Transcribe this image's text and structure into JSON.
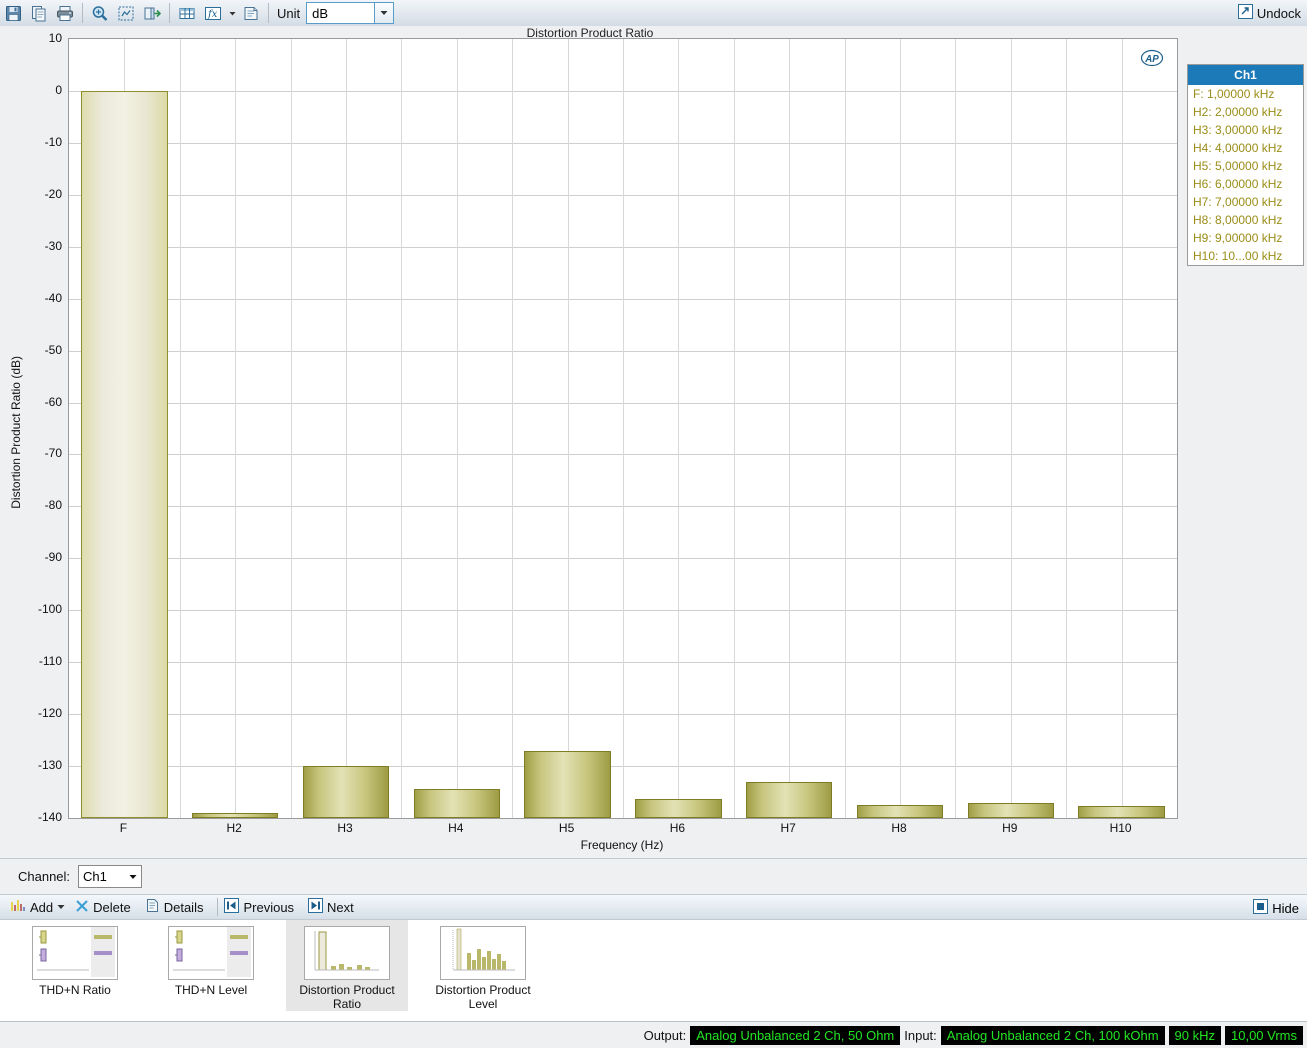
{
  "toolbar": {
    "icons": [
      {
        "name": "save-icon",
        "glyph": "save"
      },
      {
        "name": "copy-icon",
        "glyph": "copy"
      },
      {
        "name": "print-icon",
        "glyph": "print"
      },
      {
        "name": "zoom-icon",
        "glyph": "zoom"
      },
      {
        "name": "fit-icon",
        "glyph": "fit"
      },
      {
        "name": "export-icon",
        "glyph": "export"
      },
      {
        "name": "table-icon",
        "glyph": "table"
      },
      {
        "name": "formula-icon",
        "glyph": "fx"
      },
      {
        "name": "properties-icon",
        "glyph": "props"
      }
    ],
    "unit_label": "Unit",
    "unit_value": "dB",
    "undock_label": "Undock"
  },
  "chart_data": {
    "type": "bar",
    "title": "Distortion Product Ratio",
    "xlabel": "Frequency (Hz)",
    "ylabel": "Distortion Product Ratio (dB)",
    "categories": [
      "F",
      "H2",
      "H3",
      "H4",
      "H5",
      "H6",
      "H7",
      "H8",
      "H9",
      "H10"
    ],
    "values": [
      0,
      -139.0,
      -130.0,
      -134.5,
      -127.0,
      -136.3,
      -133.0,
      -137.5,
      -137.2,
      -137.7
    ],
    "ylim": [
      -140,
      10
    ],
    "yticks": [
      10,
      0,
      -10,
      -20,
      -30,
      -40,
      -50,
      -60,
      -70,
      -80,
      -90,
      -100,
      -110,
      -120,
      -130,
      -140
    ],
    "grid": true,
    "legend_position": "right",
    "series": [
      {
        "name": "Ch1",
        "values": [
          0,
          -139.0,
          -130.0,
          -134.5,
          -127.0,
          -136.3,
          -133.0,
          -137.5,
          -137.2,
          -137.7
        ]
      }
    ],
    "watermark": "AP"
  },
  "legend": {
    "header": "Ch1",
    "items": [
      "F: 1,00000 kHz",
      "H2: 2,00000 kHz",
      "H3: 3,00000 kHz",
      "H4: 4,00000 kHz",
      "H5: 5,00000 kHz",
      "H6: 6,00000 kHz",
      "H7: 7,00000 kHz",
      "H8: 8,00000 kHz",
      "H9: 9,00000 kHz",
      "H10: 10...00 kHz"
    ],
    "header_color": "#1d7ab8",
    "text_color": "#9a8d18"
  },
  "channel_bar": {
    "label": "Channel:",
    "value": "Ch1"
  },
  "action_bar": {
    "add_label": "Add",
    "delete_label": "Delete",
    "details_label": "Details",
    "previous_label": "Previous",
    "next_label": "Next",
    "hide_label": "Hide"
  },
  "thumbnails": [
    {
      "caption": "THD+N Ratio",
      "selected": false,
      "kind": "meter"
    },
    {
      "caption": "THD+N Level",
      "selected": false,
      "kind": "meter"
    },
    {
      "caption": "Distortion Product Ratio",
      "selected": true,
      "kind": "bars-single"
    },
    {
      "caption": "Distortion Product Level",
      "selected": false,
      "kind": "bars-many"
    }
  ],
  "statusbar": {
    "output_label": "Output:",
    "output_value": "Analog Unbalanced 2 Ch, 50 Ohm",
    "input_label": "Input:",
    "input_value": "Analog Unbalanced 2 Ch, 100 kOhm",
    "bandwidth": "90 kHz",
    "level": "10,00 Vrms",
    "value_color": "#22e622"
  }
}
